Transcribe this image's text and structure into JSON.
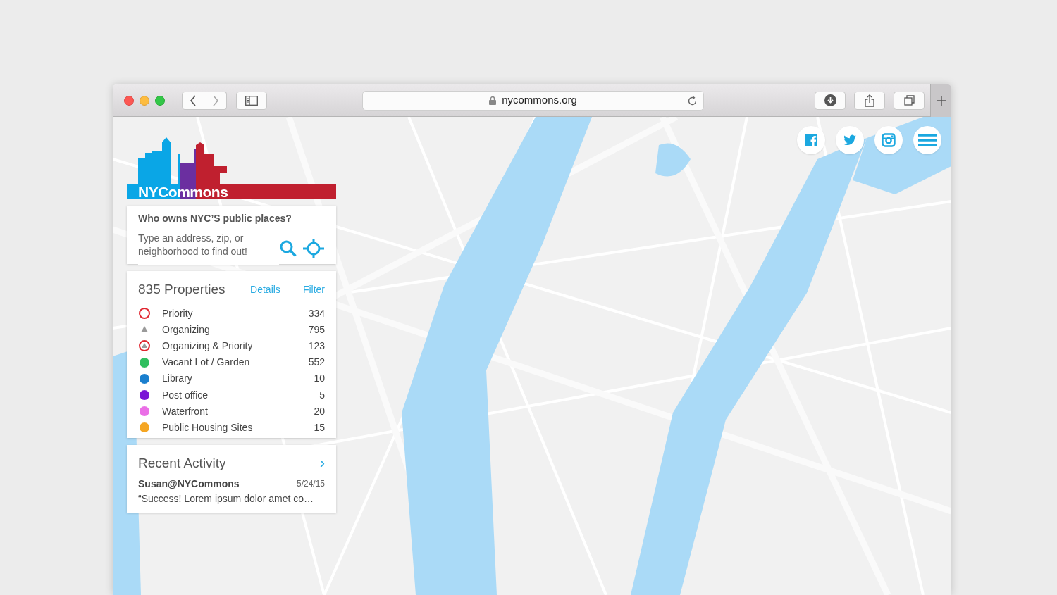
{
  "browser": {
    "url": "nycommons.org"
  },
  "social_buttons": [
    {
      "kind": "facebook"
    },
    {
      "kind": "twitter"
    },
    {
      "kind": "instagram"
    },
    {
      "kind": "menu"
    }
  ],
  "logo": {
    "text": "NYCommons"
  },
  "search": {
    "question": "Who owns NYC’S public places?",
    "placeholder": "Type an address, zip, or neighborhood to find out!"
  },
  "properties": {
    "title": "835 Properties",
    "links": [
      "Details",
      "Filter"
    ],
    "items": [
      {
        "label": "Priority",
        "count": "334",
        "kind": "ring",
        "color": "#e0252f"
      },
      {
        "label": "Organizing",
        "count": "795",
        "kind": "triangle",
        "color": "#9a9a9a"
      },
      {
        "label": "Organizing & Priority",
        "count": "123",
        "kind": "ring-triangle",
        "color": "#e0252f"
      },
      {
        "label": "Vacant Lot / Garden",
        "count": "552",
        "kind": "dot",
        "color": "#2fbf5f"
      },
      {
        "label": "Library",
        "count": "10",
        "kind": "dot",
        "color": "#1a7fce"
      },
      {
        "label": "Post office",
        "count": "5",
        "kind": "dot",
        "color": "#7a16d6"
      },
      {
        "label": "Waterfront",
        "count": "20",
        "kind": "dot",
        "color": "#ea6fe6"
      },
      {
        "label": "Public Housing Sites",
        "count": "15",
        "kind": "dot",
        "color": "#f5a623"
      }
    ]
  },
  "recent_activity": {
    "title": "Recent Activity",
    "chevron": "›",
    "entries": [
      {
        "user": "Susan@NYCommons",
        "date": "5/24/15",
        "text": "“Success! Lorem ipsum dolor amet co…"
      }
    ]
  }
}
